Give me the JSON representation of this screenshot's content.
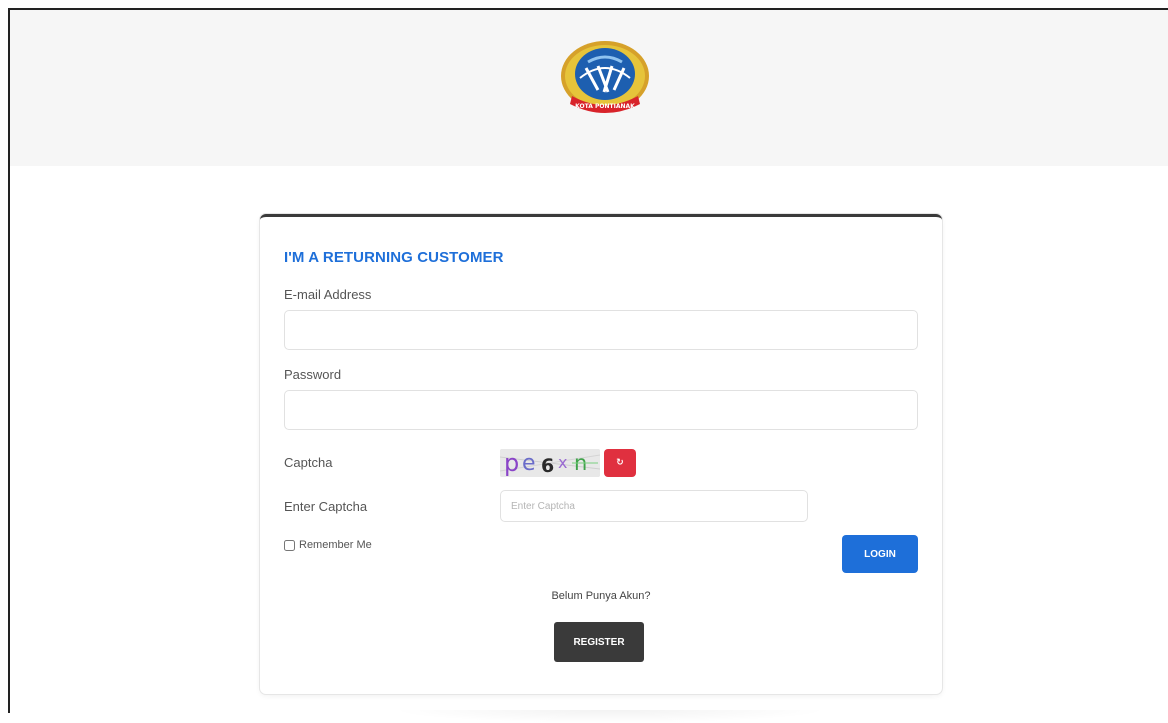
{
  "header": {
    "logo_text": "KOTA PONTIANAK"
  },
  "login": {
    "title": "I'M A RETURNING CUSTOMER",
    "email_label": "E-mail Address",
    "email_value": "",
    "password_label": "Password",
    "password_value": "",
    "captcha_label": "Captcha",
    "captcha_text": "pe6xn",
    "refresh_label": "↻",
    "enter_captcha_label": "Enter Captcha",
    "enter_captcha_placeholder": "Enter Captcha",
    "remember_label": "Remember Me",
    "remember_checked": false,
    "login_button": "LOGIN",
    "no_account_text": "Belum Punya Akun?",
    "register_button": "REGISTER"
  },
  "colors": {
    "accent": "#1e6fd9",
    "danger": "#e0303f",
    "dark": "#3a3a3a",
    "header_bg": "#f6f6f6"
  }
}
